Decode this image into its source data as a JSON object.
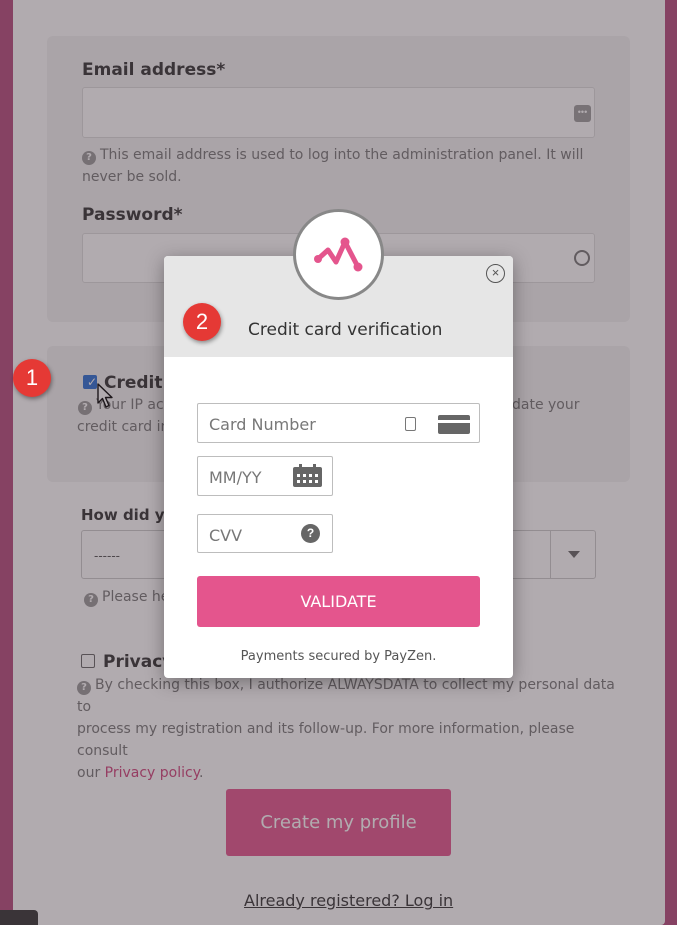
{
  "form": {
    "email_label": "Email address*",
    "email_help": "This email address is used to log into the administration panel. It will never be sold.",
    "password_label": "Password*",
    "credit_card_label_visible": "Credit c",
    "credit_card_help_left_1": "Your IP ac",
    "credit_card_help_right_1": "date your",
    "credit_card_help_left_2": "credit card inf",
    "how_did_you_label": "How did you",
    "select_value": "------",
    "select_help": "Please he",
    "privacy_label": "Privacy",
    "privacy_help_1": "By checking this box, I authorize ALWAYSDATA to collect my personal data to",
    "privacy_help_2": "process my registration and its follow-up. For more information, please consult",
    "privacy_help_3_prefix": "our ",
    "privacy_link": "Privacy policy",
    "privacy_help_3_suffix": ".",
    "create_button": "Create my profile",
    "login_link": "Already registered? Log in"
  },
  "modal": {
    "title": "Credit card verification",
    "card_number_placeholder": "Card Number",
    "expiry_placeholder": "MM/YY",
    "cvv_placeholder": "CVV",
    "validate_button": "VALIDATE",
    "secured_text": "Payments secured by PayZen.",
    "close_symbol": "×"
  },
  "annotations": {
    "badge_1": "1",
    "badge_2": "2"
  },
  "colors": {
    "brand_pink": "#e4558d",
    "page_border": "#b54a7c",
    "badge_red": "#e53935",
    "checkbox_blue": "#2a6ed4"
  }
}
